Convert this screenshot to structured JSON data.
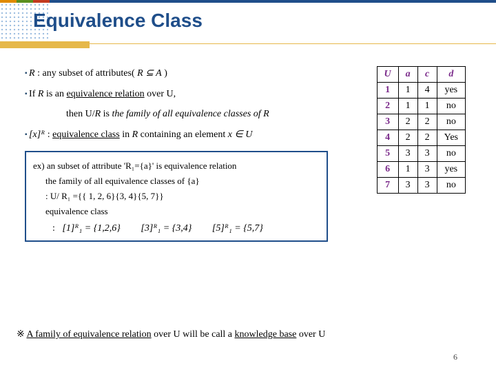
{
  "title": "Equivalence Class",
  "bullets": {
    "b1_pre": "R",
    "b1_mid": "  : any subset of attributes(  ",
    "b1_math": "R ⊆ A",
    "b1_post": "  )",
    "b2_pre": "If ",
    "b2_R": "R",
    "b2_mid": " is an ",
    "b2_u": "equivalence relation",
    "b2_post": " over U,",
    "b2_then_pre": "then U/",
    "b2_then_R": "R",
    "b2_then_mid": " is ",
    "b2_then_ital": "the family of all equivalence classes of R",
    "b3_math": "[x]ᴿ",
    "b3_mid": " : ",
    "b3_u": "equivalence class",
    "b3_post1": " in ",
    "b3_R": "R",
    "b3_post2": " containing an element ",
    "b3_end": "x ∈ U"
  },
  "example": {
    "l1": "ex) an subset of attribute 'R₁={a}' is equivalence relation",
    "l2": "the family of all equivalence classes of {a}",
    "l3": ": U/ R₁ ={{ 1, 2, 6}{3, 4}{5, 7}}",
    "l4": "equivalence class",
    "colon": ":",
    "eq1": "[1]ᴿ₁ = {1,2,6}",
    "eq2": "[3]ᴿ₁ = {3,4}",
    "eq3": "[5]ᴿ₁ = {5,7}"
  },
  "table": {
    "headers": [
      "U",
      "a",
      "c",
      "d"
    ],
    "rows": [
      [
        "1",
        "1",
        "4",
        "yes"
      ],
      [
        "2",
        "1",
        "1",
        "no"
      ],
      [
        "3",
        "2",
        "2",
        "no"
      ],
      [
        "4",
        "2",
        "2",
        "Yes"
      ],
      [
        "5",
        "3",
        "3",
        "no"
      ],
      [
        "6",
        "1",
        "3",
        "yes"
      ],
      [
        "7",
        "3",
        "3",
        "no"
      ]
    ]
  },
  "footer": "※ A family of equivalence relation over U will be call a knowledge base over U",
  "footer_u1": "A family of equivalence relation",
  "footer_mid": " over U will be call a ",
  "footer_u2": "knowledge base",
  "footer_end": " over U",
  "pageno": "6"
}
